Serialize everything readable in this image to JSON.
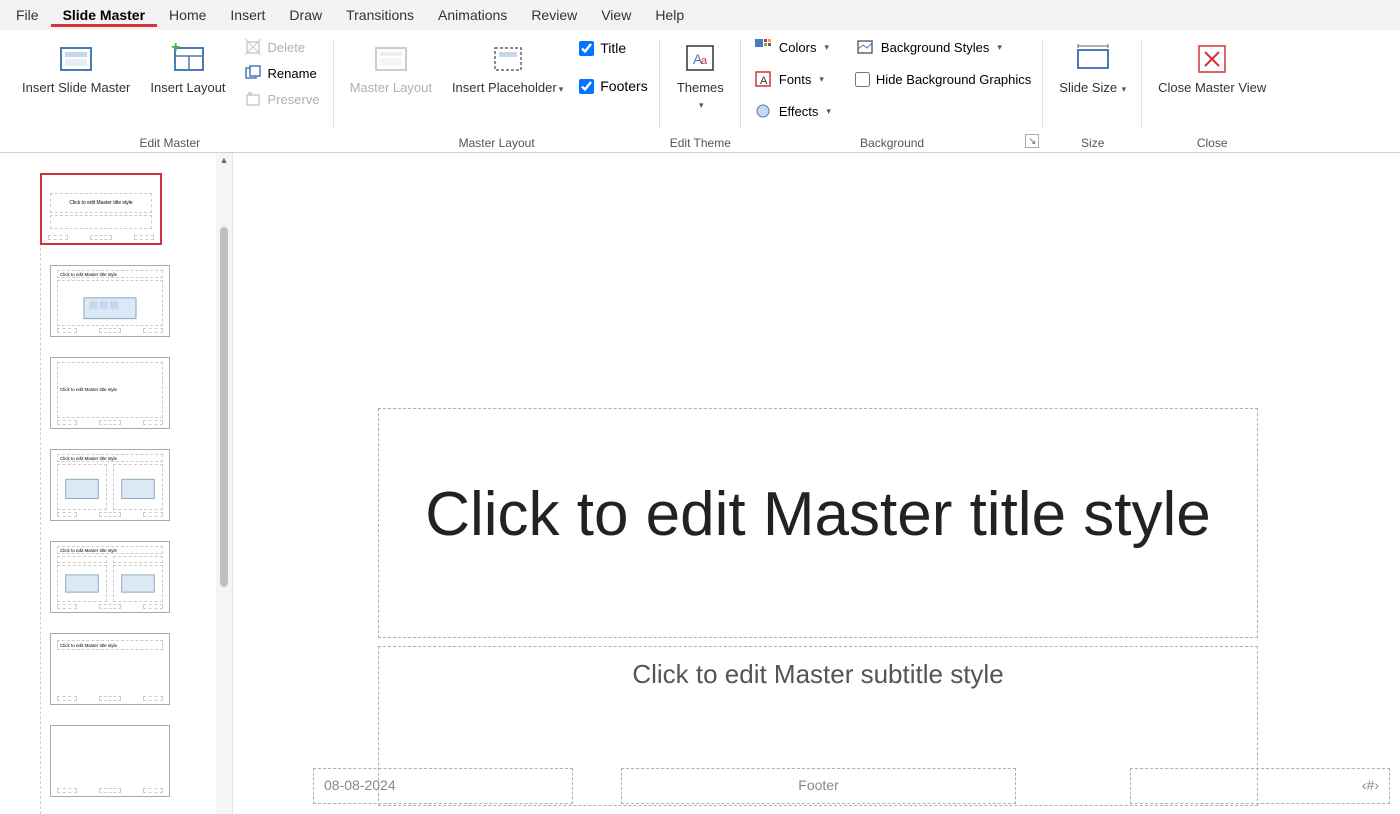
{
  "menu": {
    "file": "File",
    "slide_master": "Slide Master",
    "home": "Home",
    "insert": "Insert",
    "draw": "Draw",
    "transitions": "Transitions",
    "animations": "Animations",
    "review": "Review",
    "view": "View",
    "help": "Help"
  },
  "ribbon": {
    "edit_master_label": "Edit Master",
    "insert_slide_master": "Insert Slide Master",
    "insert_layout": "Insert Layout",
    "delete": "Delete",
    "rename": "Rename",
    "preserve": "Preserve",
    "master_layout_group": "Master Layout",
    "master_layout": "Master Layout",
    "insert_placeholder": "Insert Placeholder",
    "title_cb": "Title",
    "footers_cb": "Footers",
    "edit_theme_label": "Edit Theme",
    "themes": "Themes",
    "background_label": "Background",
    "colors": "Colors",
    "fonts": "Fonts",
    "effects": "Effects",
    "bg_styles": "Background Styles",
    "hide_bg": "Hide Background Graphics",
    "size_label": "Size",
    "slide_size": "Slide Size",
    "close_label": "Close",
    "close_master": "Close Master View"
  },
  "slide": {
    "title_text": "Click to edit Master title style",
    "subtitle_text": "Click to edit Master subtitle style",
    "date_text": "08-08-2024",
    "footer_text": "Footer",
    "number_text": "‹#›"
  },
  "thumbs": {
    "t1": "Click to edit Master title style",
    "t2": "Click to edit Master title style",
    "t3": "Click to edit Master title style",
    "t4": "Click to edit Master title style",
    "t5": "Click to edit Master title style",
    "t6": "Click to edit Master title style"
  }
}
